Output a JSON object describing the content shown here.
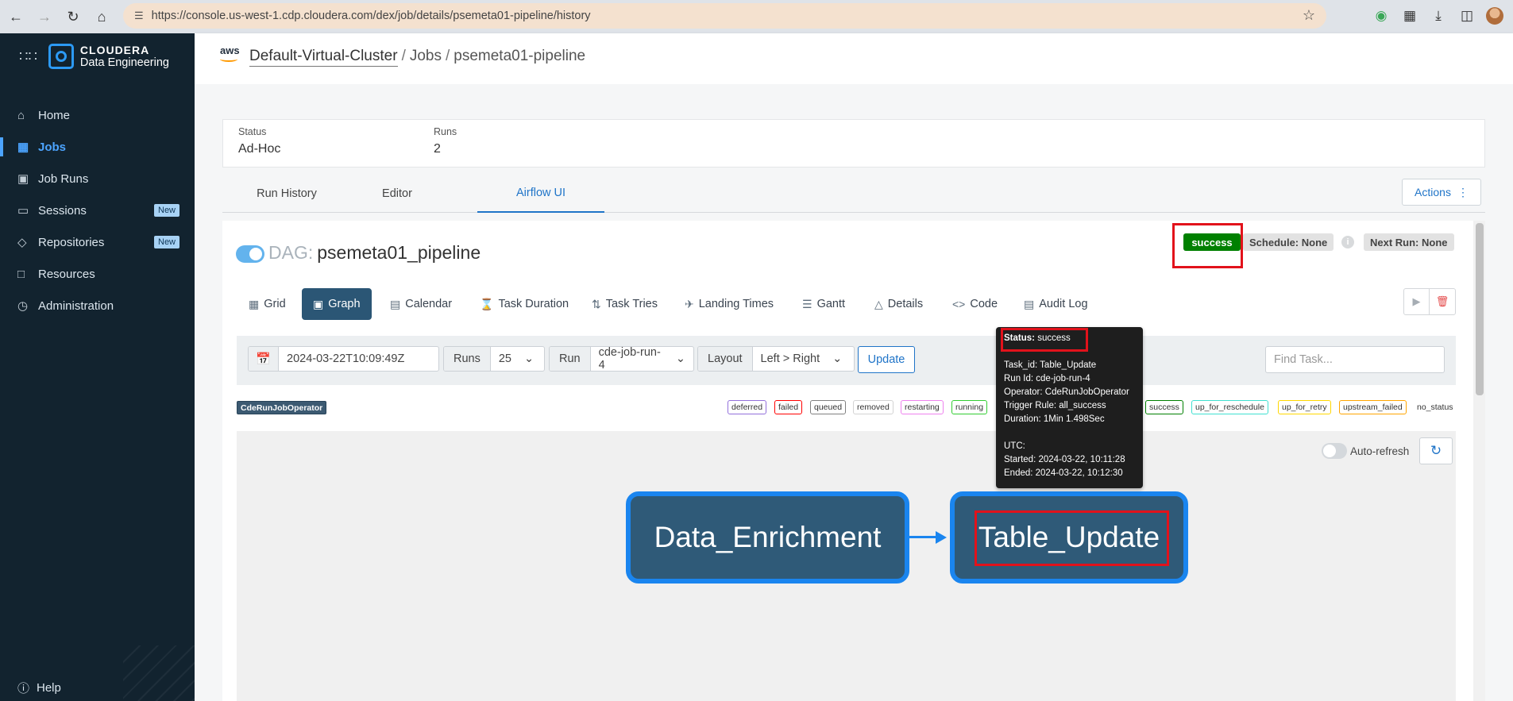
{
  "browser": {
    "url": "https://console.us-west-1.cdp.cloudera.com/dex/job/details/psemeta01-pipeline/history"
  },
  "sidebar": {
    "brand_line1": "CLOUDERA",
    "brand_line2": "Data Engineering",
    "items": [
      {
        "label": "Home",
        "icon": "home-icon"
      },
      {
        "label": "Jobs",
        "icon": "jobs-icon",
        "active": true
      },
      {
        "label": "Job Runs",
        "icon": "job-runs-icon"
      },
      {
        "label": "Sessions",
        "icon": "sessions-icon",
        "badge": "New"
      },
      {
        "label": "Repositories",
        "icon": "repositories-icon",
        "badge": "New"
      },
      {
        "label": "Resources",
        "icon": "resources-icon"
      },
      {
        "label": "Administration",
        "icon": "administration-icon"
      }
    ],
    "help": "Help"
  },
  "header": {
    "provider": "aws",
    "breadcrumb": [
      "Default-Virtual-Cluster",
      "Jobs",
      "psemeta01-pipeline"
    ]
  },
  "summary": {
    "status_label": "Status",
    "status_value": "Ad-Hoc",
    "runs_label": "Runs",
    "runs_value": "2"
  },
  "tabs": [
    "Run History",
    "Editor",
    "Airflow UI"
  ],
  "active_tab": "Airflow UI",
  "actions_label": "Actions",
  "dag": {
    "prefix": "DAG:",
    "name": "psemeta01_pipeline",
    "status": "success",
    "schedule": "Schedule: None",
    "next_run": "Next Run: None"
  },
  "view_tabs": [
    "Grid",
    "Graph",
    "Calendar",
    "Task Duration",
    "Task Tries",
    "Landing Times",
    "Gantt",
    "Details",
    "Code",
    "Audit Log"
  ],
  "active_view": "Graph",
  "filters": {
    "date": "2024-03-22T10:09:49Z",
    "runs_label": "Runs",
    "runs_value": "25",
    "run_label": "Run",
    "run_value": "cde-job-run-4",
    "layout_label": "Layout",
    "layout_value": "Left > Right",
    "update": "Update",
    "find_placeholder": "Find Task..."
  },
  "operator_tag": "CdeRunJobOperator",
  "legend": [
    {
      "label": "deferred",
      "color": "#9370db"
    },
    {
      "label": "failed",
      "color": "#ff0000"
    },
    {
      "label": "queued",
      "color": "#808080"
    },
    {
      "label": "removed",
      "color": "#d3d3d3"
    },
    {
      "label": "restarting",
      "color": "#ee82ee"
    },
    {
      "label": "running",
      "color": "#32cd32"
    },
    {
      "label": "success",
      "color": "#008000"
    },
    {
      "label": "up_for_reschedule",
      "color": "#40e0d0"
    },
    {
      "label": "up_for_retry",
      "color": "#ffd700"
    },
    {
      "label": "upstream_failed",
      "color": "#ffa500"
    },
    {
      "label": "no_status",
      "color": ""
    }
  ],
  "auto_refresh": "Auto-refresh",
  "graph": {
    "nodes": [
      "Data_Enrichment",
      "Table_Update"
    ]
  },
  "tooltip": {
    "status_key": "Status:",
    "status_val": "success",
    "task_id": "Task_id: Table_Update",
    "run_id": "Run Id: cde-job-run-4",
    "operator": "Operator: CdeRunJobOperator",
    "trigger_rule": "Trigger Rule: all_success",
    "duration": "Duration: 1Min 1.498Sec",
    "utc": "UTC:",
    "started": "Started: 2024-03-22, 10:11:28",
    "ended": "Ended: 2024-03-22, 10:12:30"
  },
  "colors": {
    "sidebar_bg": "#12232f",
    "accent": "#1f74c8",
    "success": "#008000",
    "highlight": "#e2121b",
    "node_fill": "#2f5a78",
    "node_border": "#1a85ef"
  }
}
